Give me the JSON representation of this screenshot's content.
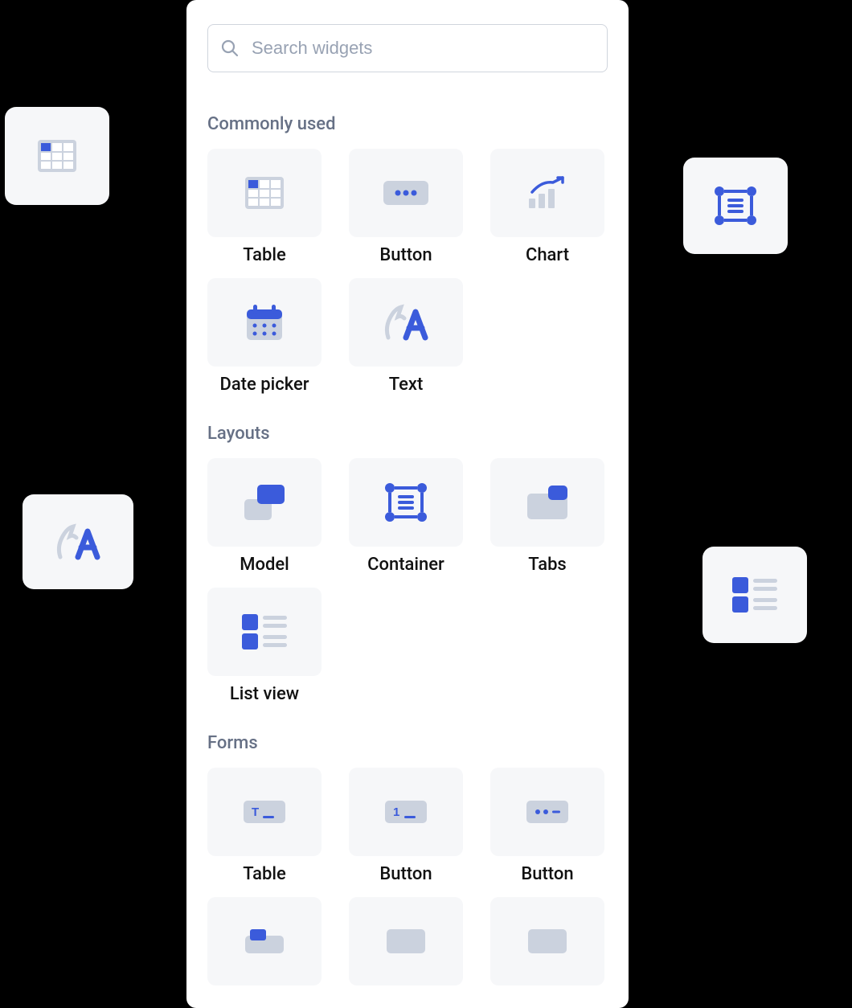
{
  "search": {
    "placeholder": "Search widgets"
  },
  "sections": {
    "commonly_used": {
      "title": "Commonly  used",
      "items": [
        {
          "label": "Table"
        },
        {
          "label": "Button"
        },
        {
          "label": "Chart"
        },
        {
          "label": "Date picker"
        },
        {
          "label": "Text"
        }
      ]
    },
    "layouts": {
      "title": "Layouts",
      "items": [
        {
          "label": "Model"
        },
        {
          "label": "Container"
        },
        {
          "label": "Tabs"
        },
        {
          "label": "List view"
        }
      ]
    },
    "forms": {
      "title": "Forms",
      "items": [
        {
          "label": "Table"
        },
        {
          "label": "Button"
        },
        {
          "label": "Button"
        }
      ]
    }
  },
  "colors": {
    "accent": "#3B5BDB",
    "muted": "#B9C0CC",
    "muted2": "#CBD2DE",
    "card": "#F6F7F9",
    "text": "#111111",
    "label": "#667085",
    "border": "#D0D5DD"
  }
}
